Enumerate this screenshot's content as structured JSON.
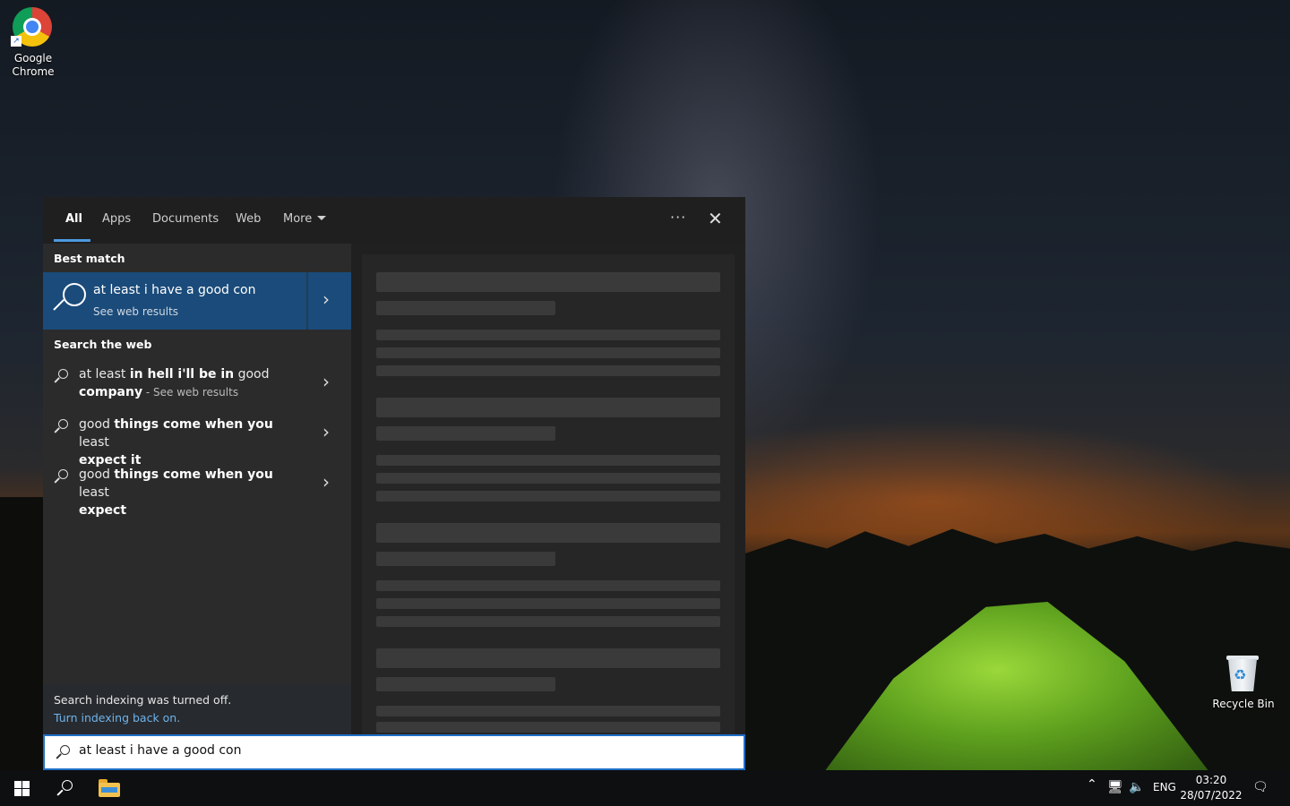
{
  "desktop": {
    "icons": [
      {
        "label": "Google\nChrome"
      },
      {
        "label": "Recycle Bin"
      }
    ]
  },
  "search_panel": {
    "tabs": [
      {
        "label": "All",
        "active": true
      },
      {
        "label": "Apps"
      },
      {
        "label": "Documents"
      },
      {
        "label": "Web"
      },
      {
        "label": "More"
      }
    ],
    "options_icon": "more-options-icon",
    "close_icon": "close-icon",
    "best_match": {
      "heading": "Best match",
      "title": "at least i have a good con",
      "subtitle": "See web results"
    },
    "search_web": {
      "heading": "Search the web",
      "items": [
        {
          "line1_plain": "at least ",
          "line1_bold": "in hell i'll be in",
          "line1_tail": " good",
          "line2_bold": "company",
          "line2_muted": " - See web results"
        },
        {
          "line1_plain": "good ",
          "line1_bold": "things come when you",
          "line1_tail": " least",
          "line2_bold": "expect it",
          "line2_muted": ""
        },
        {
          "line1_plain": "good ",
          "line1_bold": "things come when you",
          "line1_tail": " least",
          "line2_bold": "expect",
          "line2_muted": ""
        }
      ]
    },
    "indexing": {
      "note": "Search indexing was turned off.",
      "link": "Turn indexing back on."
    },
    "search_box": {
      "value": "at least i have a good con"
    }
  },
  "taskbar": {
    "language": "ENG",
    "time": "03:20",
    "date": "28/07/2022"
  },
  "colors": {
    "accent": "#1a4b7a",
    "link": "#6fb3ec",
    "search_border": "#1f6fc5"
  }
}
